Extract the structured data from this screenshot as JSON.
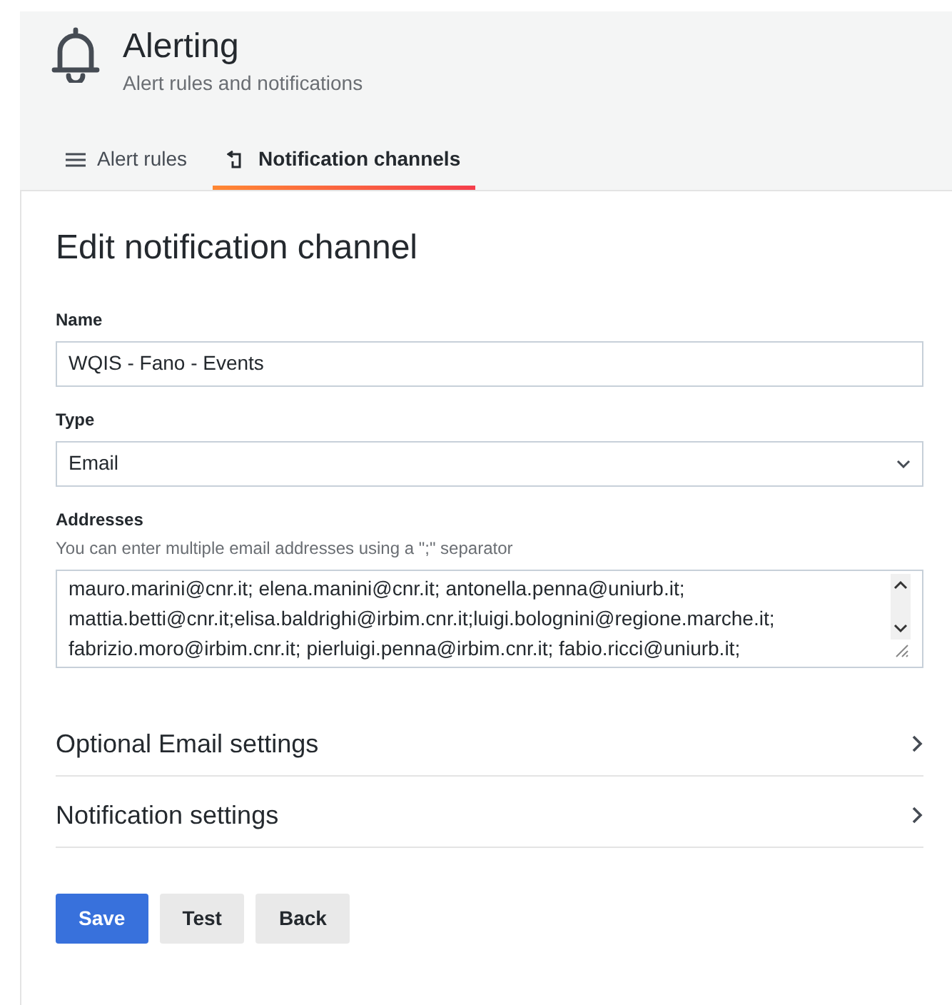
{
  "header": {
    "title": "Alerting",
    "subtitle": "Alert rules and notifications"
  },
  "tabs": [
    {
      "label": "Alert rules",
      "kind": "list",
      "selected": false
    },
    {
      "label": "Notification channels",
      "kind": "channels",
      "selected": true
    }
  ],
  "form": {
    "heading": "Edit notification channel",
    "name": {
      "label": "Name",
      "value": "WQIS - Fano - Events"
    },
    "type": {
      "label": "Type",
      "value": "Email"
    },
    "addresses": {
      "label": "Addresses",
      "description": "You can enter multiple email addresses using a \";\" separator",
      "lines": [
        "mauro.marini@cnr.it; elena.manini@cnr.it; antonella.penna@uniurb.it;",
        "mattia.betti@cnr.it;elisa.baldrighi@irbim.cnr.it;luigi.bolognini@regione.marche.it;",
        "fabrizio.moro@irbim.cnr.it; pierluigi.penna@irbim.cnr.it; fabio.ricci@uniurb.it;"
      ]
    },
    "sections": [
      {
        "title": "Optional Email settings",
        "expanded": false
      },
      {
        "title": "Notification settings",
        "expanded": false
      }
    ],
    "buttons": [
      {
        "label": "Save",
        "kind": "primary"
      },
      {
        "label": "Test",
        "kind": "secondary"
      },
      {
        "label": "Back",
        "kind": "secondary"
      }
    ]
  }
}
